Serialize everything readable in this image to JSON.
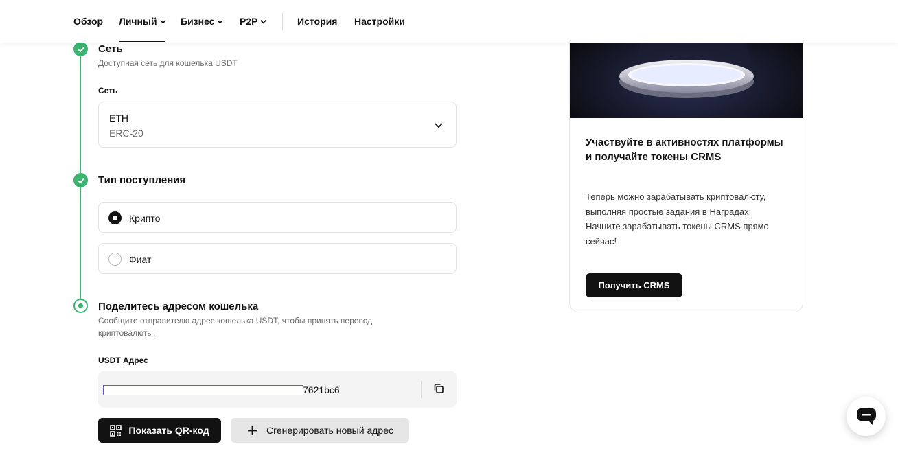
{
  "nav": {
    "items": [
      {
        "label": "Обзор",
        "dropdown": false
      },
      {
        "label": "Личный",
        "dropdown": true
      },
      {
        "label": "Бизнес",
        "dropdown": true
      },
      {
        "label": "P2P",
        "dropdown": true
      },
      {
        "label": "История",
        "dropdown": false
      },
      {
        "label": "Настройки",
        "dropdown": false
      }
    ],
    "active": "Личный"
  },
  "steps": {
    "network": {
      "title": "Сеть",
      "subtitle": "Доступная сеть для кошелька USDT",
      "field_label": "Сеть",
      "selected_primary": "ETH",
      "selected_secondary": "ERC-20"
    },
    "deposit_type": {
      "title": "Тип поступления",
      "options": [
        {
          "label": "Крипто",
          "selected": true
        },
        {
          "label": "Фиат",
          "selected": false
        }
      ]
    },
    "share_address": {
      "title": "Поделитесь адресом кошелька",
      "subtitle": "Сообщите отправителю адрес кошелька USDT, чтобы принять перевод криптовалюты.",
      "field_label": "USDT Адрес",
      "address_suffix": "7621bc6",
      "show_qr_label": "Показать QR-код",
      "generate_label": "Сгенерировать новый адрес"
    }
  },
  "promo": {
    "title": "Участвуйте в активностях платформы и получайте токены CRMS",
    "text": "Теперь можно зарабатывать криптовалюту, выполняя простые задания в Наградах. Начните зарабатывать токены CRMS прямо сейчас!",
    "button": "Получить CRMS"
  },
  "colors": {
    "accent_green": "#3cb371",
    "dark": "#121212",
    "mask_border": "#6a5acd"
  }
}
